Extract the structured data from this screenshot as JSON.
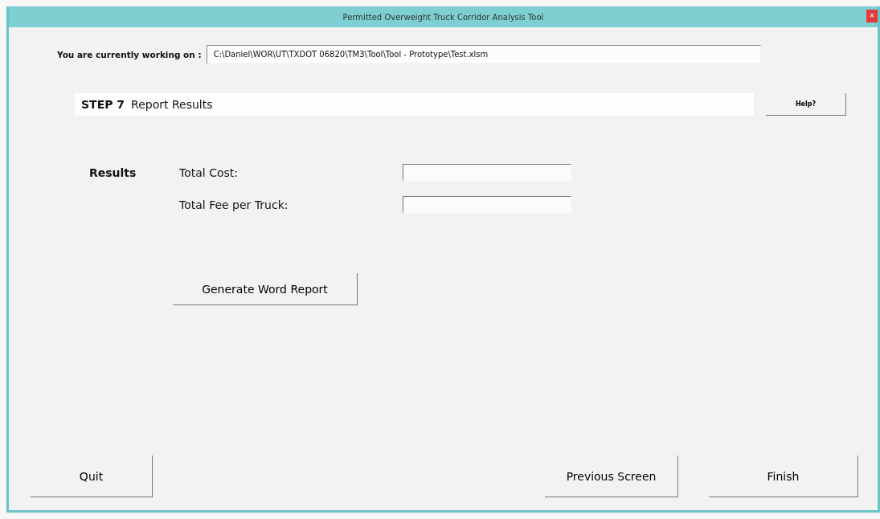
{
  "window": {
    "title": "Permitted Overweight Truck Corridor Analysis Tool",
    "close": "×"
  },
  "file": {
    "label": "You are currently working on :",
    "value": "C:\\Daniel\\WOR\\UT\\TXDOT 06820\\TM3\\Tool\\Tool - Prototype\\Test.xlsm"
  },
  "step": {
    "number": "STEP 7",
    "title": "Report Results",
    "help": "Help?"
  },
  "results": {
    "heading": "Results",
    "fields": [
      {
        "label": "Total Cost:"
      },
      {
        "label": "Total Fee per Truck:"
      }
    ]
  },
  "generate_button": "Generate Word Report",
  "buttons": {
    "quit": "Quit",
    "previous": "Previous Screen",
    "finish": "Finish"
  }
}
